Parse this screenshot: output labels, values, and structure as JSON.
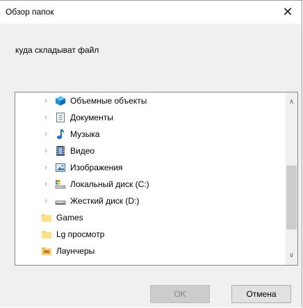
{
  "window": {
    "title": "Обзор папок",
    "close_glyph": "✕"
  },
  "prompt": "куда складыват файл",
  "tree": {
    "items": [
      {
        "label": "Объемные объекты",
        "icon": "3d-objects-icon",
        "expandable": true
      },
      {
        "label": "Документы",
        "icon": "documents-icon",
        "expandable": true
      },
      {
        "label": "Музыка",
        "icon": "music-icon",
        "expandable": true
      },
      {
        "label": "Видео",
        "icon": "video-icon",
        "expandable": true
      },
      {
        "label": "Изображения",
        "icon": "pictures-icon",
        "expandable": true
      },
      {
        "label": "Локальный диск (C:)",
        "icon": "local-disk-icon",
        "expandable": true
      },
      {
        "label": "Жесткий диск (D:)",
        "icon": "hard-disk-icon",
        "expandable": true
      },
      {
        "label": "Games",
        "icon": "folder-icon",
        "expandable": false
      },
      {
        "label": "Lg просмотр",
        "icon": "folder-icon",
        "expandable": false
      },
      {
        "label": "Лаунчеры",
        "icon": "folder-icon",
        "expandable": false
      }
    ],
    "chevron_glyph": "›"
  },
  "scrollbar": {
    "up_glyph": "∧",
    "down_glyph": "∨"
  },
  "buttons": {
    "ok": "OK",
    "cancel": "Отмена"
  }
}
